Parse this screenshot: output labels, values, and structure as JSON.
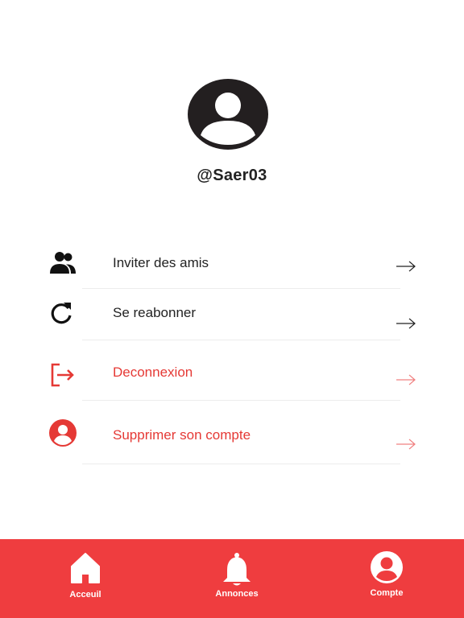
{
  "profile": {
    "avatar_icon": "user-circle-icon",
    "username": "@Saer03"
  },
  "menu": {
    "items": [
      {
        "label": "Inviter des amis",
        "icon": "people-icon",
        "color": "#222222"
      },
      {
        "label": "Se reabonner",
        "icon": "refresh-icon",
        "color": "#222222"
      },
      {
        "label": "Deconnexion",
        "icon": "logout-icon",
        "color": "#e53935"
      },
      {
        "label": "Supprimer son compte",
        "icon": "delete-account-icon",
        "color": "#e53935"
      }
    ]
  },
  "bottom_nav": {
    "background": "#ef3d3f",
    "items": [
      {
        "label": "Acceuil",
        "icon": "home-icon"
      },
      {
        "label": "Annonces",
        "icon": "bell-icon"
      },
      {
        "label": "Compte",
        "icon": "account-circle-icon"
      }
    ]
  }
}
